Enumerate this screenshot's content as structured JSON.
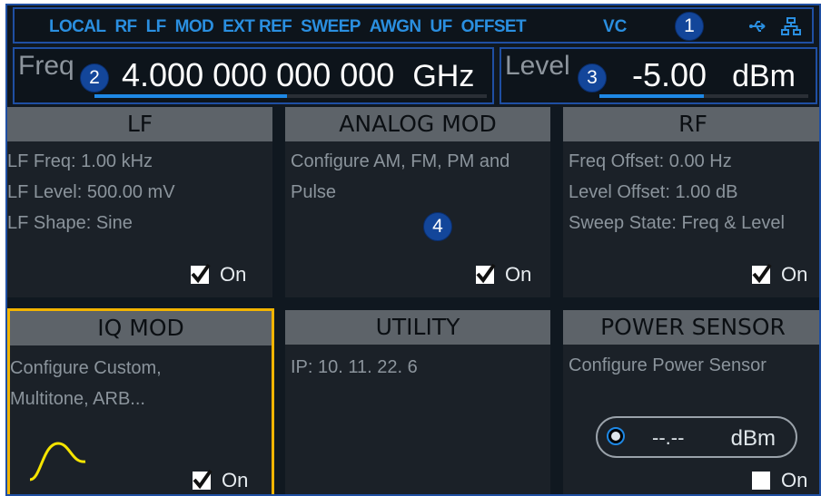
{
  "status_bar": {
    "items": [
      "LOCAL",
      "RF",
      "LF",
      "MOD",
      "EXT REF",
      "SWEEP",
      "AWGN",
      "UF",
      "OFFSET"
    ],
    "vc": "VC",
    "icons": [
      "usb-icon",
      "network-icon"
    ]
  },
  "badges": [
    "1",
    "2",
    "3",
    "4"
  ],
  "frequency": {
    "label": "Freq",
    "value": "4.000 000 000 000",
    "unit": "GHz",
    "slider_level": 0.49
  },
  "level": {
    "label": "Level",
    "value": "-5.00",
    "unit": "dBm",
    "slider_level": 0.5
  },
  "tiles": {
    "lf": {
      "title": "LF",
      "lines": [
        "LF Freq: 1.00 kHz",
        "LF Level: 500.00 mV",
        "LF Shape: Sine"
      ],
      "on_label": "On",
      "checked": true
    },
    "analog_mod": {
      "title": "ANALOG MOD",
      "lines": [
        "Configure AM, FM, PM and",
        "Pulse"
      ],
      "on_label": "On",
      "checked": true
    },
    "rf": {
      "title": "RF",
      "lines": [
        "Freq Offset: 0.00 Hz",
        "Level Offset: 1.00 dB",
        "Sweep State: Freq & Level"
      ],
      "on_label": "On",
      "checked": true
    },
    "iq_mod": {
      "title": "IQ MOD",
      "lines": [
        "Configure Custom,",
        "Multitone, ARB..."
      ],
      "on_label": "On",
      "checked": true
    },
    "utility": {
      "title": "UTILITY",
      "lines": [
        "IP:  10. 11. 22.  6"
      ]
    },
    "power_sensor": {
      "title": "POWER SENSOR",
      "lines": [
        "Configure Power Sensor"
      ],
      "reading": "--.--",
      "unit": "dBm",
      "on_label": "On",
      "checked": false
    }
  },
  "colors": {
    "accent_blue": "#2a8fe0",
    "badge_blue": "#13469a",
    "selected_border": "#f2b400",
    "waveform": "#f5e400"
  }
}
